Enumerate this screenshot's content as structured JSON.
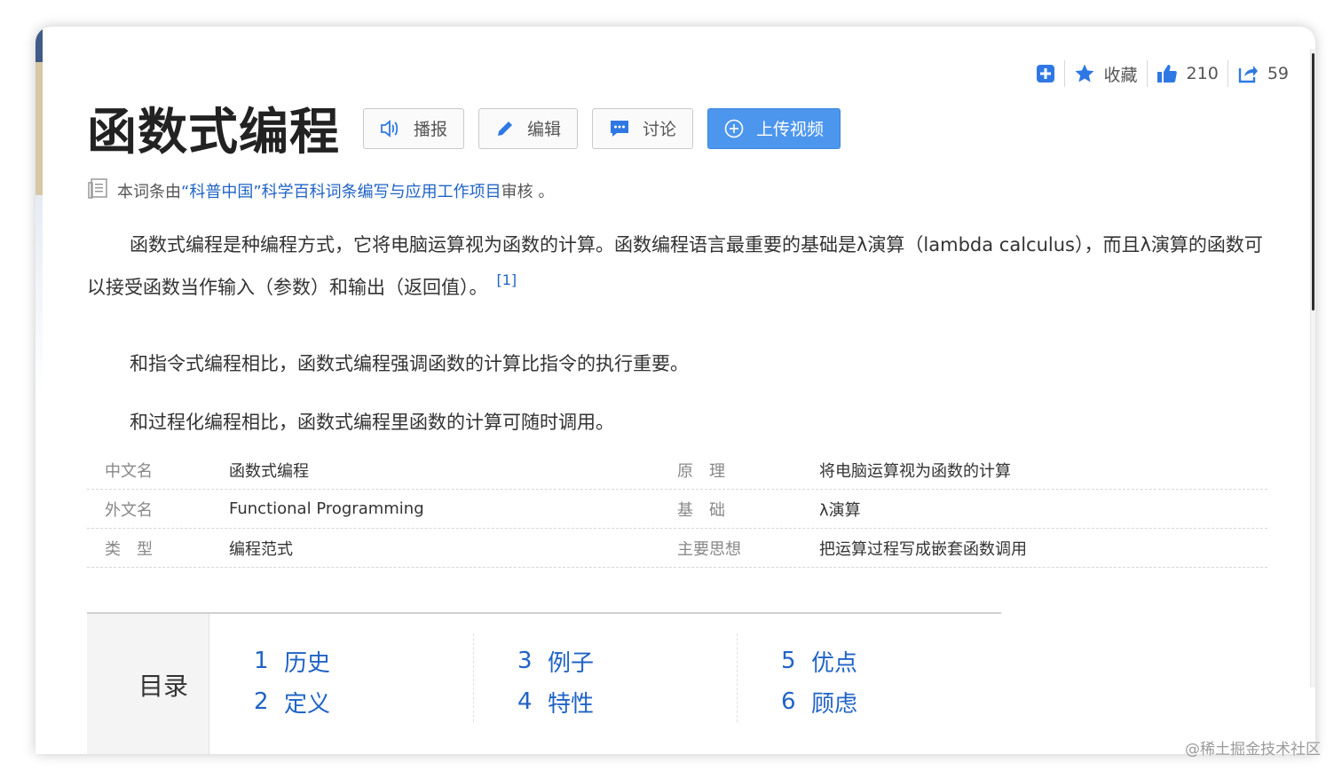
{
  "actions": {
    "collect_label": "收藏",
    "like_count": "210",
    "share_count": "59"
  },
  "title": "函数式编程",
  "buttons": {
    "broadcast": "播报",
    "edit": "编辑",
    "discuss": "讨论",
    "upload_video": "上传视频"
  },
  "review": {
    "prefix": "本词条由",
    "link": "“科普中国”科学百科词条编写与应用工作项目",
    "suffix": " 审核 。"
  },
  "paragraphs": {
    "p1": "函数式编程是种编程方式，它将电脑运算视为函数的计算。函数编程语言最重要的基础是λ演算（lambda calculus），而且λ演算的函数可以接受函数当作输入（参数）和输出（返回值）。",
    "p1_ref": "[1]",
    "p2": "和指令式编程相比，函数式编程强调函数的计算比指令的执行重要。",
    "p3": "和过程化编程相比，函数式编程里函数的计算可随时调用。"
  },
  "info": [
    {
      "k": "中文名",
      "v": "函数式编程",
      "k2": "原　理",
      "v2": "将电脑运算视为函数的计算"
    },
    {
      "k": "外文名",
      "v": "Functional Programming",
      "k2": "基　础",
      "v2": "λ演算"
    },
    {
      "k": "类　型",
      "v": "编程范式",
      "k2": "主要思想",
      "v2": "把运算过程写成嵌套函数调用"
    }
  ],
  "toc": {
    "title": "目录",
    "items": [
      {
        "n": "1",
        "label": "历史"
      },
      {
        "n": "2",
        "label": "定义"
      },
      {
        "n": "3",
        "label": "例子"
      },
      {
        "n": "4",
        "label": "特性"
      },
      {
        "n": "5",
        "label": "优点"
      },
      {
        "n": "6",
        "label": "顾虑"
      }
    ]
  },
  "watermark": "@稀土掘金技术社区",
  "colors": {
    "link": "#1f63c6",
    "primary_button": "#4d96ee",
    "icon_blue": "#2f78e4"
  },
  "icons": [
    "add-icon",
    "star-icon",
    "thumbs-up-icon",
    "share-icon",
    "speaker-icon",
    "pencil-icon",
    "chat-icon",
    "plus-circle-icon",
    "document-icon"
  ]
}
